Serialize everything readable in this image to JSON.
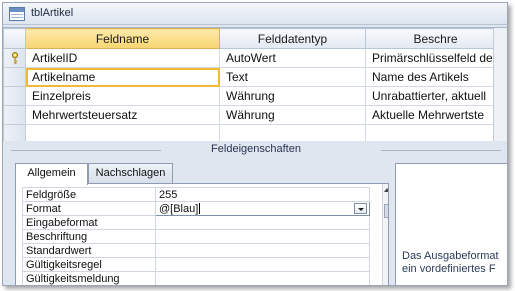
{
  "window": {
    "title": "tblArtikel"
  },
  "grid": {
    "columns": [
      "Feldname",
      "Felddatentyp",
      "Beschre"
    ],
    "rows": [
      {
        "name": "ArtikelID",
        "type": "AutoWert",
        "description": "Primärschlüsselfeld de",
        "is_key": true
      },
      {
        "name": "Artikelname",
        "type": "Text",
        "description": "Name des Artikels",
        "is_key": false
      },
      {
        "name": "Einzelpreis",
        "type": "Währung",
        "description": "Unrabattierter, aktuell",
        "is_key": false
      },
      {
        "name": "Mehrwertsteuersatz",
        "type": "Währung",
        "description": "Aktuelle Mehrwertste",
        "is_key": false
      },
      {
        "name": "",
        "type": "",
        "description": "",
        "is_key": false
      }
    ]
  },
  "properties": {
    "section_title": "Feldeigenschaften",
    "tabs": [
      "Allgemein",
      "Nachschlagen"
    ],
    "active_tab": "Allgemein",
    "rows": [
      {
        "label": "Feldgröße",
        "value": "255"
      },
      {
        "label": "Format",
        "value": "@[Blau]"
      },
      {
        "label": "Eingabeformat",
        "value": ""
      },
      {
        "label": "Beschriftung",
        "value": ""
      },
      {
        "label": "Standardwert",
        "value": ""
      },
      {
        "label": "Gültigkeitsregel",
        "value": ""
      },
      {
        "label": "Gültigkeitsmeldung",
        "value": ""
      }
    ],
    "help_lines": [
      "Das Ausgabeformat",
      "ein vordefiniertes F"
    ]
  },
  "colors": {
    "active_header": "#f8d572",
    "focus_outline": "#f0b93a"
  }
}
